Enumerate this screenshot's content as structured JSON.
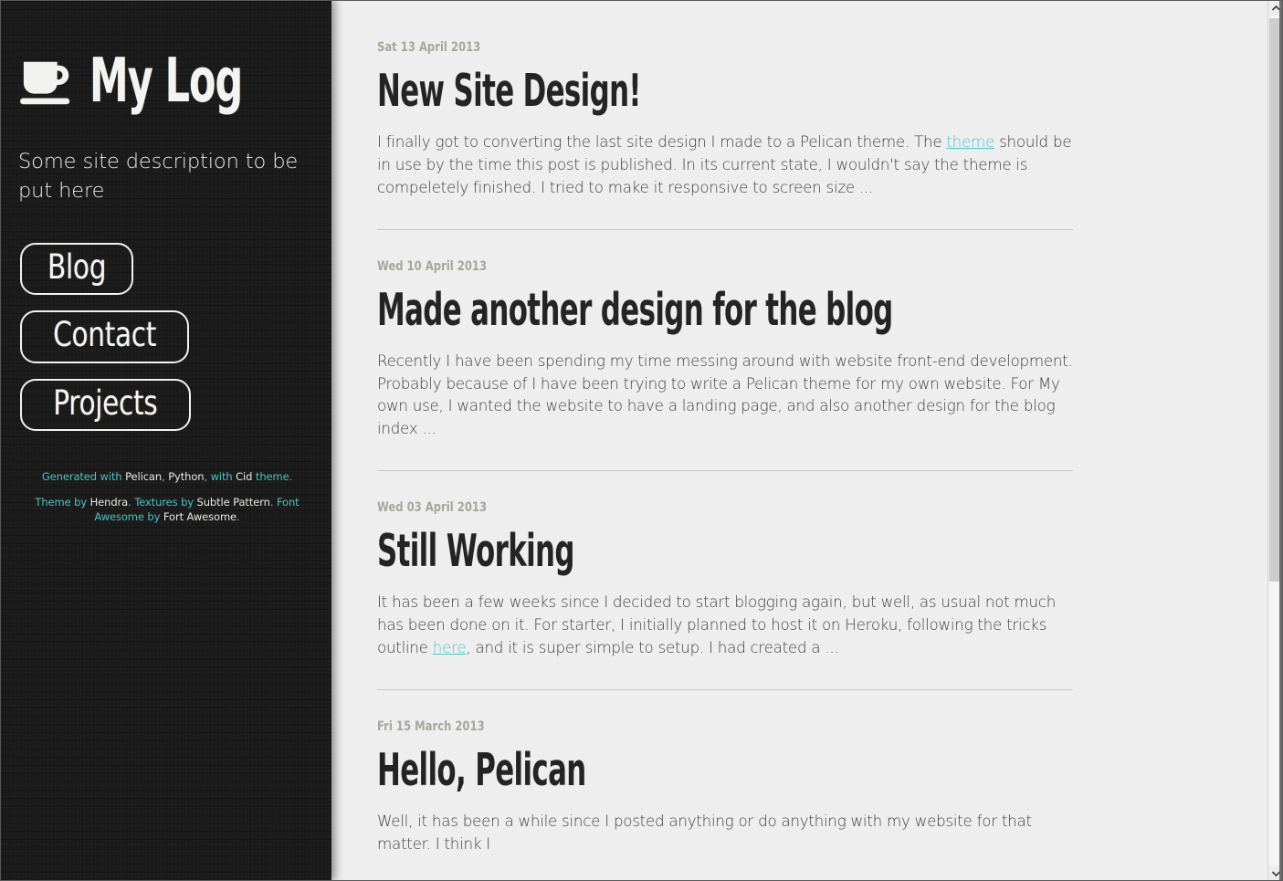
{
  "site": {
    "title": "My Log",
    "logo_icon": "coffee-cup-icon",
    "description": "Some site description to be put here"
  },
  "nav": {
    "items": [
      {
        "label": "Blog"
      },
      {
        "label": "Contact"
      },
      {
        "label": "Projects"
      }
    ]
  },
  "credits": {
    "line1": {
      "t1": "Generated with ",
      "link1": "Pelican",
      "t2": ", ",
      "link2": "Python",
      "t3": ", with ",
      "link3": "Cid",
      "t4": " theme."
    },
    "line2": {
      "t1": "Theme by ",
      "link1": "Hendra",
      "t2": ". Textures by ",
      "link2": "Subtle Pattern",
      "t3": ". Font Awesome by ",
      "link3": "Fort Awesome",
      "t4": "."
    }
  },
  "articles": [
    {
      "date": "Sat 13 April 2013",
      "title": "New Site Design!",
      "summary_pre": "I finally got to converting the last site design I made to a Pelican theme. The ",
      "summary_link": "theme",
      "summary_post": " should be in use by the time this post is published. In its current state, I wouldn't say the theme is compeletely finished. I tried to make it responsive to screen size ..."
    },
    {
      "date": "Wed 10 April 2013",
      "title": "Made another design for the blog",
      "summary_pre": "Recently I have been spending my time messing around with website front-end development. Probably because of I have been trying to write a Pelican theme for my own website. For My own use, I wanted the website to have a landing page, and also another design for the blog index ...",
      "summary_link": "",
      "summary_post": ""
    },
    {
      "date": "Wed 03 April 2013",
      "title": "Still Working",
      "summary_pre": "It has been a few weeks since I decided to start blogging again, but well, as usual not much has been done on it. For starter, I initially planned to host it on Heroku, following the tricks outline ",
      "summary_link": "here",
      "summary_post": ", and it is super simple to setup. I had created a ..."
    },
    {
      "date": "Fri 15 March 2013",
      "title": "Hello, Pelican",
      "summary_pre": "Well, it has been a while since I posted anything or do anything with my website for that matter. I think I",
      "summary_link": "",
      "summary_post": ""
    }
  ],
  "colors": {
    "sidebar_bg": "#1a1a1a",
    "content_bg": "#eeeeee",
    "accent_teal": "#4cc6c6",
    "date_gray": "#a6a69c",
    "title_dark": "#242424"
  },
  "scrollbar": {
    "up_arrow_icon": "chevron-up-icon",
    "down_arrow_icon": "chevron-down-icon"
  }
}
